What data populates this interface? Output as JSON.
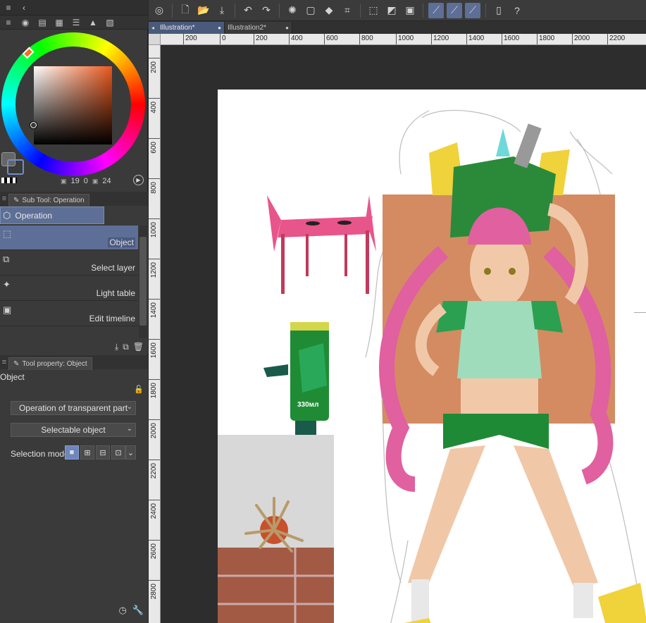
{
  "toolbar": {
    "buttons": [
      "app-icon",
      "new-icon",
      "open-icon",
      "save-icon",
      "undo-icon",
      "redo-icon",
      "loading-icon",
      "clear-icon",
      "fill-icon",
      "transform-icon",
      "deselect-icon",
      "invert-icon",
      "border-icon",
      "snap-ruler-icon",
      "snap-special-icon",
      "snap-grid-icon",
      "device-icon",
      "help-icon"
    ]
  },
  "doc_tabs": [
    {
      "label": "Illustration*",
      "active": true
    },
    {
      "label": "Illustration2*",
      "active": false
    }
  ],
  "ruler_h": [
    "200",
    "0",
    "200",
    "400",
    "600",
    "800",
    "1000",
    "1200",
    "1400",
    "1600",
    "1800",
    "2000",
    "2200"
  ],
  "ruler_v": [
    "200",
    "400",
    "600",
    "800",
    "1000",
    "1200",
    "1400",
    "1600",
    "1800",
    "2000",
    "2200",
    "2400",
    "2600",
    "2800"
  ],
  "color": {
    "main_hex": "#666666",
    "hue_hex": "#e9581c",
    "values": {
      "h": "19",
      "s": "0",
      "v": "24"
    }
  },
  "subtool": {
    "tab_label": "Sub Tool: Operation",
    "group_label": "Operation",
    "items": [
      {
        "label": "Object",
        "icon": "object-arrow-icon",
        "selected": true
      },
      {
        "label": "Select layer",
        "icon": "select-layer-icon",
        "selected": false
      },
      {
        "label": "Light table",
        "icon": "light-table-icon",
        "selected": false
      },
      {
        "label": "Edit timeline",
        "icon": "edit-timeline-icon",
        "selected": false
      }
    ]
  },
  "toolprop": {
    "tab_label": "Tool property: Object",
    "title": "Object",
    "dropdown1": "Operation of transparent part",
    "dropdown2": "Selectable object",
    "selection_mode_label": "Selection mode"
  },
  "canvas": {
    "can_label": "330мл"
  }
}
